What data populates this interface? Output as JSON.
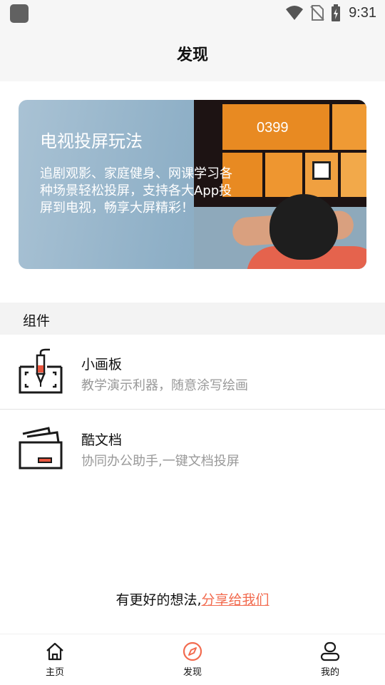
{
  "statusbar": {
    "time": "9:31"
  },
  "header": {
    "title": "发现"
  },
  "banner": {
    "title": "电视投屏玩法",
    "description": "追剧观影、家庭健身、网课学习各种场景轻松投屏，支持各大App投屏到电视，畅享大屏精彩！",
    "tv_code": "0399"
  },
  "section": {
    "title": "组件"
  },
  "items": [
    {
      "title": "小画板",
      "subtitle": "教学演示利器，随意涂写绘画"
    },
    {
      "title": "酷文档",
      "subtitle": "协同办公助手,一键文档投屏"
    }
  ],
  "feedback": {
    "prefix": "有更好的想法,",
    "link": "分享给我们"
  },
  "tabs": [
    {
      "label": "主页",
      "icon": "home-icon"
    },
    {
      "label": "发现",
      "icon": "compass-icon",
      "active": true
    },
    {
      "label": "我的",
      "icon": "user-icon"
    }
  ],
  "colors": {
    "accent": "#f26b4f",
    "banner_tile": "#e88a22",
    "muted_text": "#999999"
  }
}
